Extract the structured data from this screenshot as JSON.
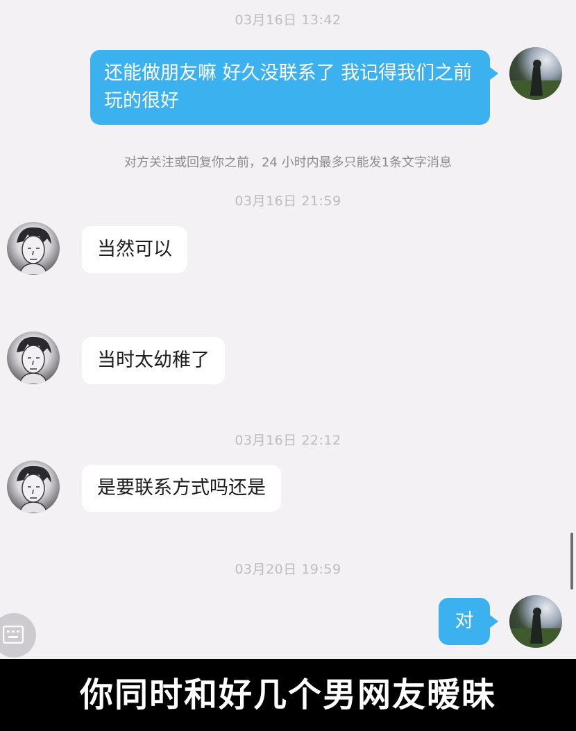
{
  "messages": {
    "ts1": "03月16日 13:42",
    "msg1": "还能做朋友嘛  好久没联系了  我记得我们之前玩的很好",
    "notice": "对方关注或回复你之前，24 小时内最多只能发1条文字消息",
    "ts2": "03月16日 21:59",
    "msg2": "当然可以",
    "msg3": "当时太幼稚了",
    "ts3": "03月16日 22:12",
    "msg4": "是要联系方式吗还是",
    "ts4": "03月20日 19:59",
    "msg5": "对"
  },
  "caption": "你同时和好几个男网友暧昧",
  "colors": {
    "outgoing_bubble": "#3cb1ef",
    "incoming_bubble": "#ffffff",
    "background": "#f4f1f5"
  },
  "icons": {
    "floating_button": "keyboard-icon"
  }
}
